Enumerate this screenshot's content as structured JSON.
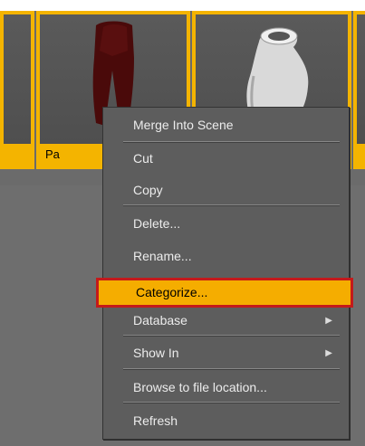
{
  "thumbnails": [
    {
      "caption": ""
    },
    {
      "caption": "Pa"
    },
    {
      "caption": ""
    },
    {
      "caption": ""
    }
  ],
  "context_menu": {
    "items": [
      {
        "label": "Merge Into Scene"
      },
      {
        "label": "Cut"
      },
      {
        "label": "Copy"
      },
      {
        "label": "Delete..."
      },
      {
        "label": "Rename..."
      },
      {
        "label": "Categorize..."
      },
      {
        "label": "Database"
      },
      {
        "label": "Show In"
      },
      {
        "label": "Browse to file location..."
      },
      {
        "label": "Refresh"
      }
    ],
    "highlighted": "Categorize...",
    "submenu_arrow": "▶"
  },
  "colors": {
    "selection": "#f4b400",
    "highlight_border": "#c41a1a",
    "menu_bg": "#5d5d5d"
  },
  "icons": [
    "pants-icon",
    "shirt-icon",
    "submenu-arrow-icon"
  ]
}
